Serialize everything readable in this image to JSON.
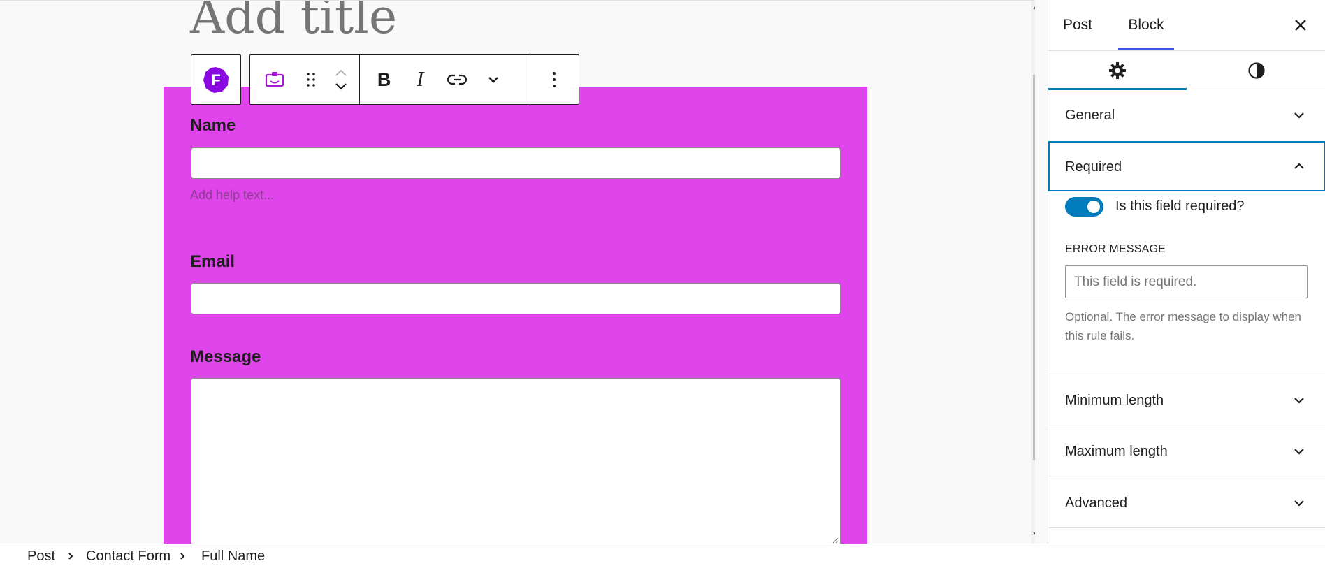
{
  "editor": {
    "title_placeholder": "Add title",
    "block_toolbar": {
      "block_icon": "forminator-f-icon",
      "block_icon_letter": "F",
      "buttons": [
        "form-field-icon",
        "drag-handle-icon",
        "move-up-icon",
        "move-down-icon",
        "bold-icon",
        "italic-icon",
        "link-icon",
        "more-rich-text-icon",
        "options-icon"
      ],
      "bold_glyph": "B",
      "italic_glyph": "I"
    },
    "form": {
      "background": "#e045ec",
      "fields": [
        {
          "label": "Name",
          "help_placeholder": "Add help text...",
          "value": ""
        },
        {
          "label": "Email",
          "value": ""
        },
        {
          "label": "Message",
          "value": ""
        }
      ]
    }
  },
  "sidebar": {
    "tabs": [
      {
        "label": "Post",
        "active": false
      },
      {
        "label": "Block",
        "active": true
      }
    ],
    "close_icon": "close-icon",
    "subtabs": [
      {
        "icon": "gear-icon",
        "active": true
      },
      {
        "icon": "contrast-icon",
        "active": false
      }
    ],
    "panels": {
      "general": "General",
      "required": {
        "title": "Required",
        "toggle_label": "Is this field required?",
        "toggle_on": true,
        "error_label": "ERROR MESSAGE",
        "error_placeholder": "This field is required.",
        "help": "Optional. The error message to display when this rule fails."
      },
      "minimum_length": "Minimum length",
      "maximum_length": "Maximum length",
      "advanced": "Advanced"
    },
    "accent": "#007cba"
  },
  "breadcrumb": [
    "Post",
    "Contact Form",
    "Full Name"
  ]
}
